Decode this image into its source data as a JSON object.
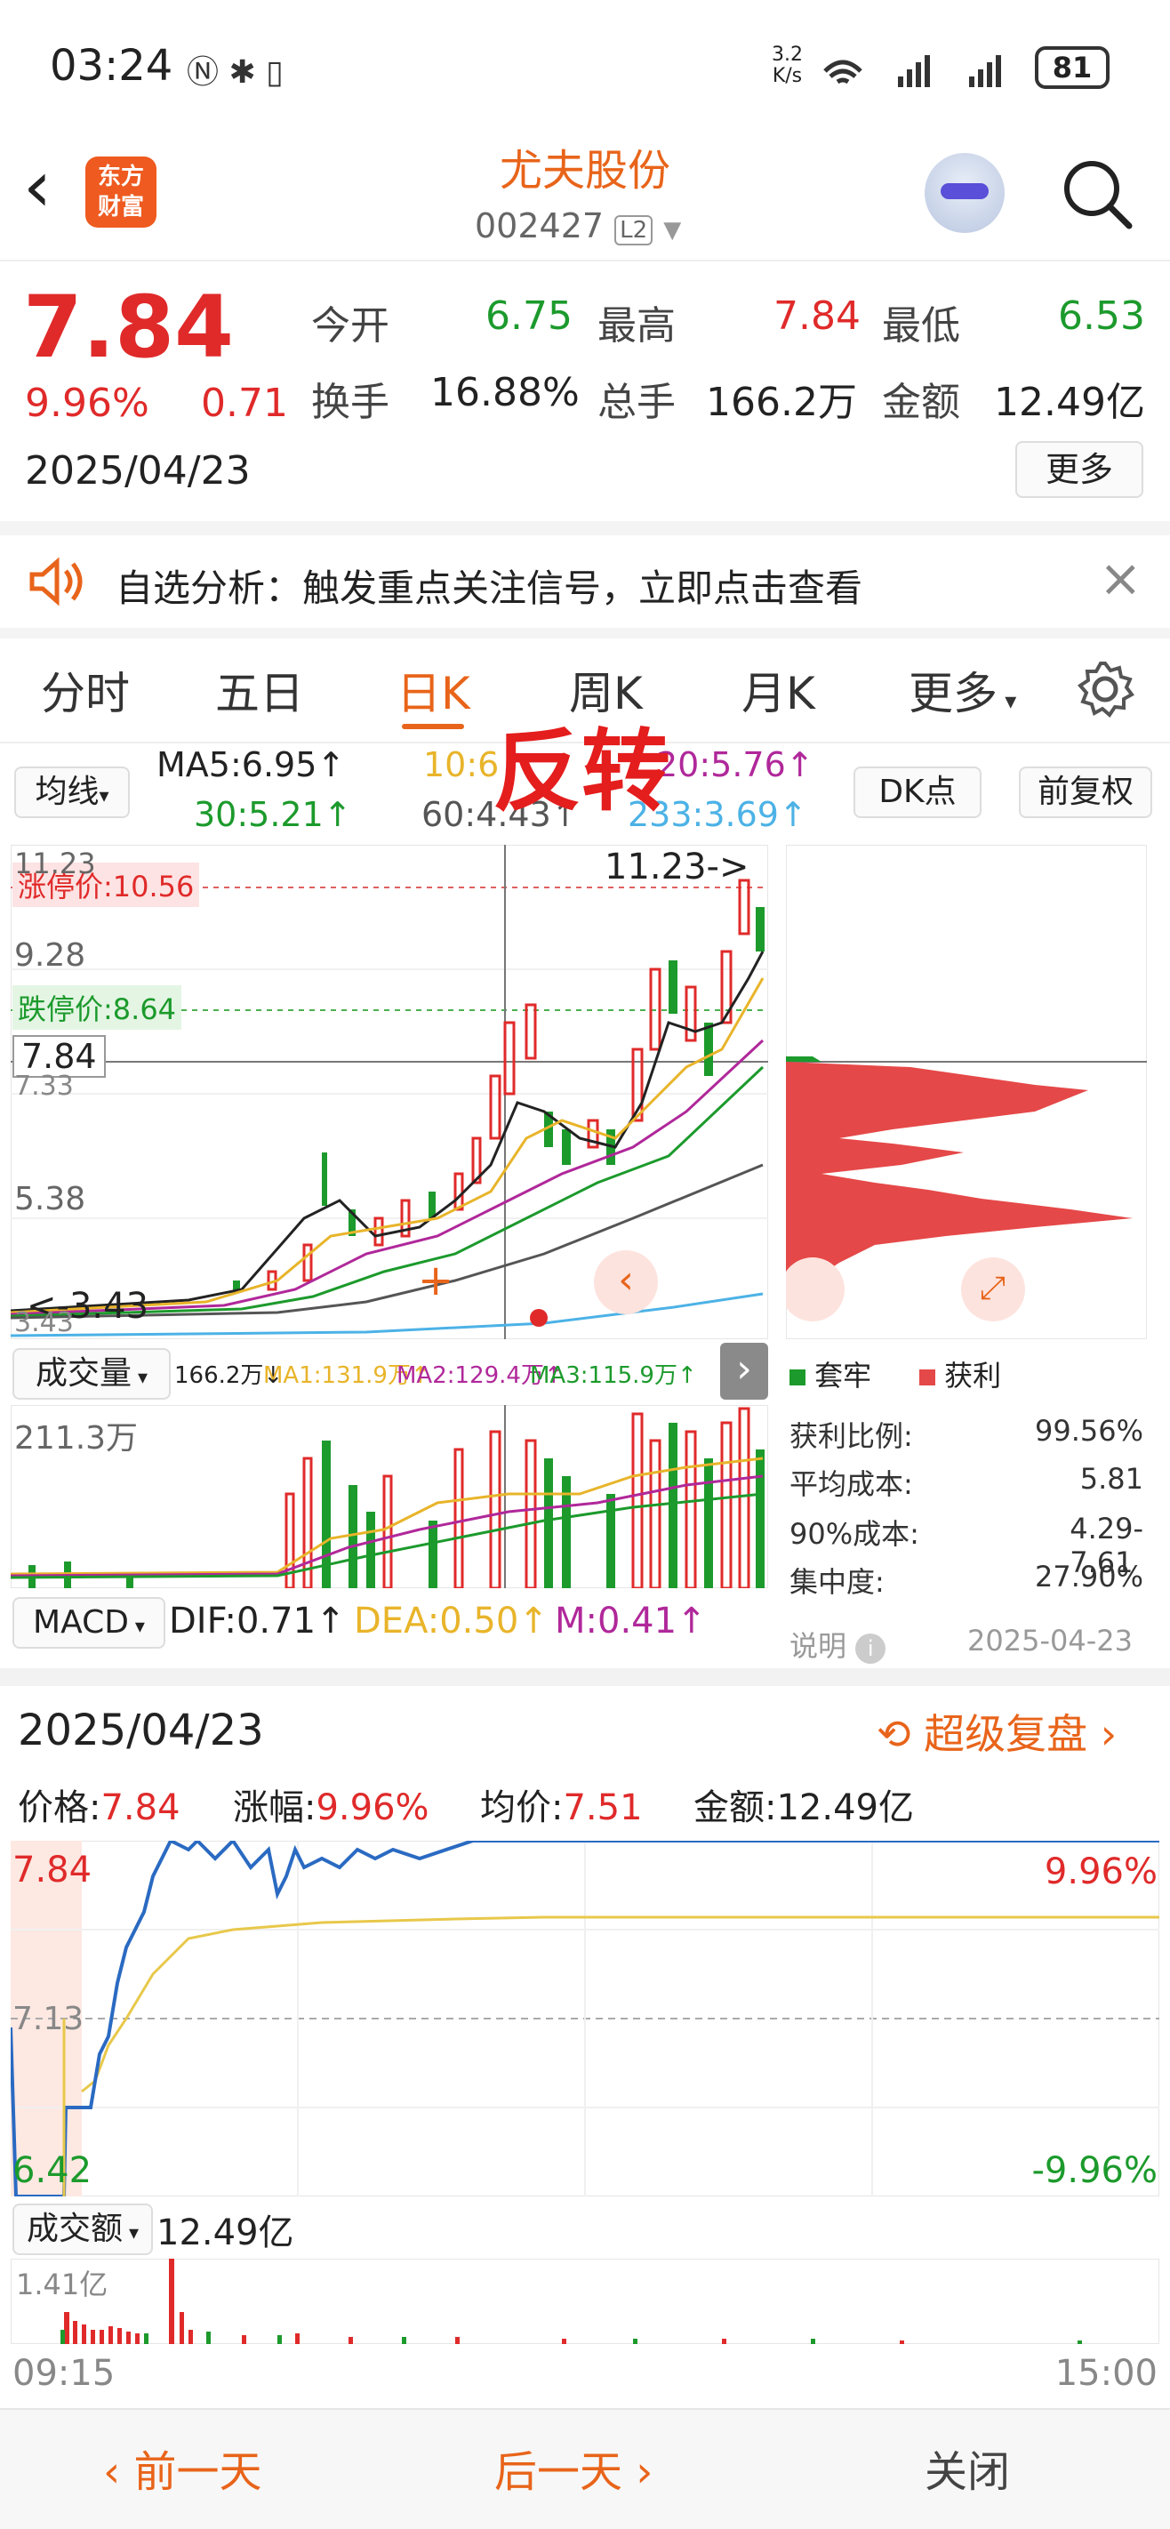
{
  "status_bar": {
    "time": "03:24",
    "net_speed_top": "3.2",
    "net_speed_bottom": "K/s",
    "battery": "81"
  },
  "header": {
    "logo_line1": "东方",
    "logo_line2": "财富",
    "title": "尤夫股份",
    "code": "002427",
    "level": "L2"
  },
  "quote": {
    "price": "7.84",
    "change_pct": "9.96%",
    "change": "0.71",
    "date": "2025/04/23",
    "open_label": "今开",
    "open": "6.75",
    "high_label": "最高",
    "high": "7.84",
    "low_label": "最低",
    "low": "6.53",
    "turnover_label": "换手",
    "turnover": "16.88%",
    "volume_label": "总手",
    "volume": "166.2万",
    "amount_label": "金额",
    "amount": "12.49亿",
    "more": "更多"
  },
  "notice": {
    "text": "自选分析：触发重点关注信号，立即点击查看"
  },
  "tabs": [
    "分时",
    "五日",
    "日K",
    "周K",
    "月K",
    "更多"
  ],
  "overlay_text": "反转",
  "ma": {
    "selector": "均线",
    "ma5": "MA5:6.95↑",
    "ma10": "10:6",
    "ma20": "20:5.76↑",
    "ma30": "30:5.21↑",
    "ma60": "60:4.43↑",
    "ma233": "233:3.69↑",
    "dk_button": "DK点",
    "adjust_button": "前复权"
  },
  "kchart": {
    "y_top": "11.23",
    "y_mid": "9.28",
    "y_low": "5.38",
    "y_price": "7.84",
    "y_partial": "7.33",
    "limit_up": "涨停价:10.56",
    "limit_down": "跌停价:8.64",
    "high_marker": "11.23->",
    "low_marker": "<-3.43",
    "bottom_partial": "3.43"
  },
  "volume_bar": {
    "selector": "成交量",
    "vol": "166.2万↓",
    "ma1": "MA1:131.9万↑",
    "ma2": "MA2:129.4万↑",
    "ma3": "MA3:115.9万↑",
    "y_max": "211.3万"
  },
  "macd_bar": {
    "selector": "MACD",
    "dif": "DIF:0.71↑",
    "dea": "DEA:0.50↑",
    "m": "M:0.41↑"
  },
  "chip": {
    "legend_trapped": "套牢",
    "legend_profit": "获利",
    "rows": [
      {
        "label": "获利比例:",
        "value": "99.56%"
      },
      {
        "label": "平均成本:",
        "value": "5.81"
      },
      {
        "label": "90%成本:",
        "value": "4.29-7.61"
      },
      {
        "label": "集中度:",
        "value": "27.90%"
      }
    ],
    "note_label": "说明",
    "note_date": "2025-04-23"
  },
  "intraday": {
    "date": "2025/04/23",
    "replay": "超级复盘",
    "price_label": "价格:",
    "price": "7.84",
    "change_label": "涨幅:",
    "change": "9.96%",
    "avg_label": "均价:",
    "avg": "7.51",
    "amount_label": "金额:",
    "amount": "12.49亿",
    "y_top": "7.84",
    "y_mid": "7.13",
    "y_bottom": "6.42",
    "pct_top": "9.96%",
    "pct_bottom": "-9.96%",
    "amount_selector": "成交额",
    "amount_total": "12.49亿",
    "vol_max": "1.41亿",
    "time_start": "09:15",
    "time_end": "15:00"
  },
  "bottom_nav": {
    "prev": "前一天",
    "next": "后一天",
    "close": "关闭"
  },
  "colors": {
    "up": "#e02a2a",
    "down": "#1c9a2c",
    "accent": "#e8641a"
  }
}
